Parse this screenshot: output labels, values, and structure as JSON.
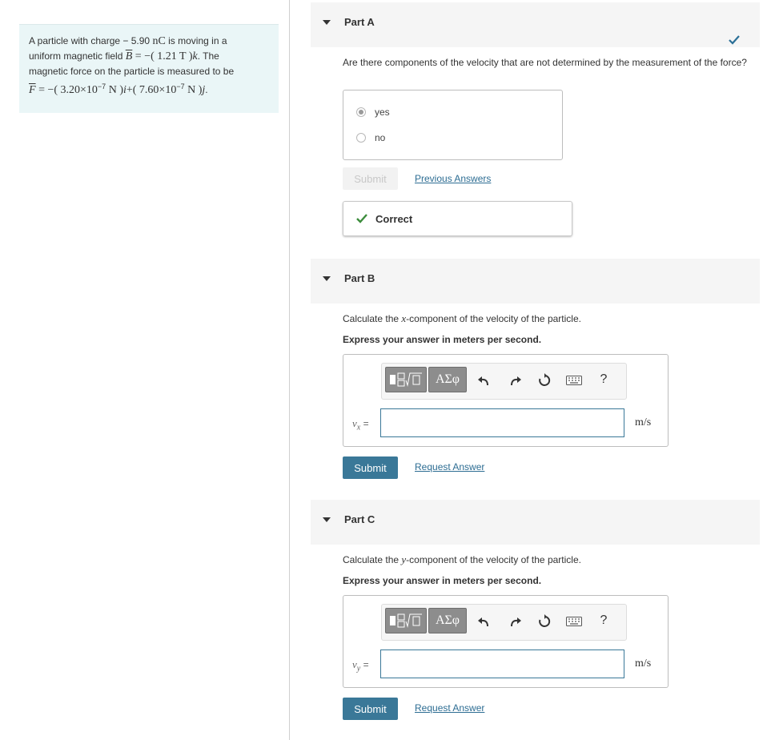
{
  "problem": {
    "line1_pre": "A particle with charge ",
    "charge": "− 5.90",
    "charge_unit": "nC",
    "line1_post": " is moving in a",
    "line2_pre": "uniform magnetic field ",
    "B_sym": "B",
    "B_expr": " = −( 1.21 ",
    "B_unit": "T",
    "B_end": " )",
    "k_hat": "k",
    "line2_post": ". The",
    "line3": "magnetic force on the particle is measured to be",
    "F_sym": "F",
    "F_pre": " = −( 3.20×10",
    "F_exp1": "−7",
    "F_unit": " N ",
    "F_mid": ")",
    "i_hat": "i",
    "F_plus": "+( 7.60×10",
    "F_exp2": "−7",
    "F_end": ")",
    "j_hat": "j",
    "F_dot": "."
  },
  "partA": {
    "title": "Part A",
    "question": "Are there components of the velocity that are not determined by the measurement of the force?",
    "options": [
      "yes",
      "no"
    ],
    "selected": "yes",
    "submit_label": "Submit",
    "previous_label": "Previous Answers",
    "feedback": "Correct",
    "status_color": "#2a6f97"
  },
  "partB": {
    "title": "Part B",
    "question_pre": "Calculate the ",
    "question_var": "x",
    "question_post": "-component of the velocity of the particle.",
    "instruction": "Express your answer in meters per second.",
    "toolbar_greek": "ΑΣφ",
    "toolbar_help": "?",
    "var_sym": "v",
    "var_sub": "x",
    "var_eq": " =",
    "unit": "m/s",
    "submit_label": "Submit",
    "request_label": "Request Answer"
  },
  "partC": {
    "title": "Part C",
    "question_pre": "Calculate the ",
    "question_var": "y",
    "question_post": "-component of the velocity of the particle.",
    "instruction": "Express your answer in meters per second.",
    "toolbar_greek": "ΑΣφ",
    "toolbar_help": "?",
    "var_sym": "v",
    "var_sub": "y",
    "var_eq": " =",
    "unit": "m/s",
    "submit_label": "Submit",
    "request_label": "Request Answer"
  },
  "colors": {
    "accent": "#3a7898",
    "correct": "#3c8c3c",
    "link": "#2d6d93"
  }
}
